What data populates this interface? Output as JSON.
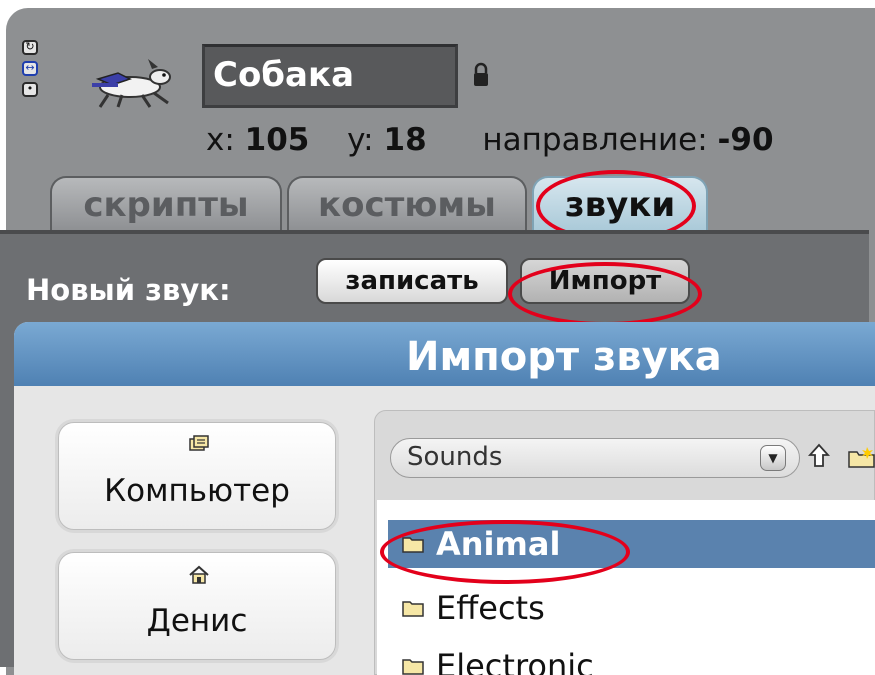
{
  "sprite": {
    "name": "Собака",
    "x_label": "x:",
    "x_value": "105",
    "y_label": "y:",
    "y_value": "18",
    "direction_label": "направление:",
    "direction_value": "-90"
  },
  "rotation_style_icons": [
    "rotate-icon",
    "left-right-icon",
    "no-rotate-icon"
  ],
  "tabs": [
    {
      "label": "скрипты",
      "active": false
    },
    {
      "label": "костюмы",
      "active": false
    },
    {
      "label": "звуки",
      "active": true
    }
  ],
  "new_sound": {
    "label": "Новый звук:",
    "record_button": "записать",
    "import_button": "Импорт"
  },
  "dialog": {
    "title": "Импорт звука",
    "places": [
      {
        "label": "Компьютер",
        "icon": "computer-icon"
      },
      {
        "label": "Денис",
        "icon": "home-icon"
      }
    ],
    "folder_select": "Sounds",
    "files": [
      {
        "name": "Animal",
        "selected": true
      },
      {
        "name": "Effects",
        "selected": false
      },
      {
        "name": "Electronic",
        "selected": false
      }
    ]
  },
  "colors": {
    "accent_highlight": "#e3001b",
    "selection": "#5a82ae",
    "titlebar": "#5f91c2"
  }
}
